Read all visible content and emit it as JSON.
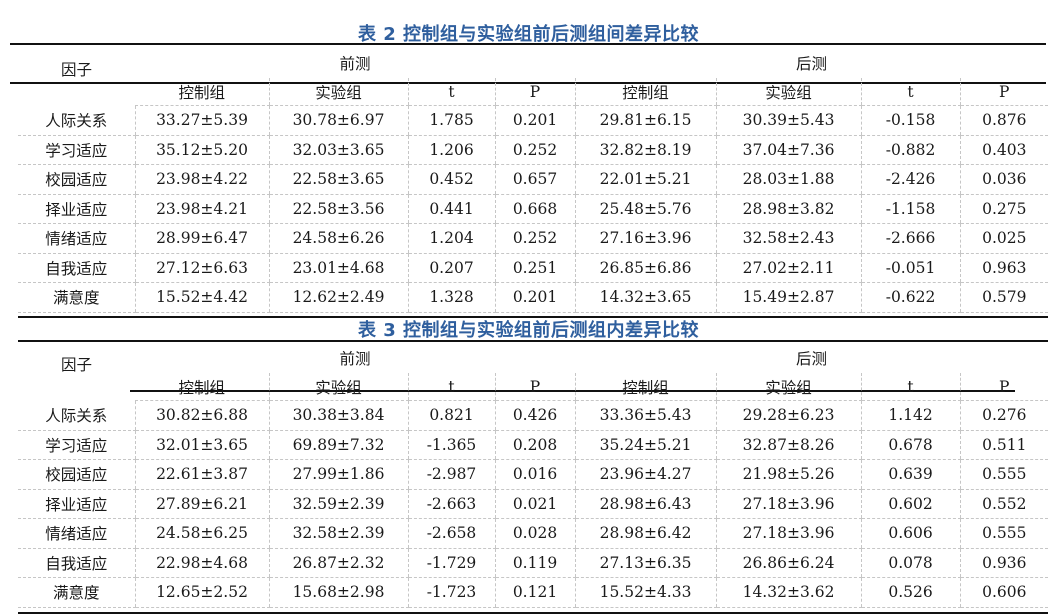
{
  "table2": {
    "title": "表 2   控制组与实验组前后测组间差异比较",
    "factor_header": "因子",
    "group_pre": "前测",
    "group_post": "后测",
    "columns": [
      "控制组",
      "实验组",
      "t",
      "P",
      "控制组",
      "实验组",
      "t",
      "P"
    ],
    "rows": [
      [
        "人际关系",
        "33.27±5.39",
        "30.78±6.97",
        "1.785",
        "0.201",
        "29.81±6.15",
        "30.39±5.43",
        "-0.158",
        "0.876"
      ],
      [
        "学习适应",
        "35.12±5.20",
        "32.03±3.65",
        "1.206",
        "0.252",
        "32.82±8.19",
        "37.04±7.36",
        "-0.882",
        "0.403"
      ],
      [
        "校园适应",
        "23.98±4.22",
        "22.58±3.65",
        "0.452",
        "0.657",
        "22.01±5.21",
        "28.03±1.88",
        "-2.426",
        "0.036"
      ],
      [
        "择业适应",
        "23.98±4.21",
        "22.58±3.56",
        "0.441",
        "0.668",
        "25.48±5.76",
        "28.98±3.82",
        "-1.158",
        "0.275"
      ],
      [
        "情绪适应",
        "28.99±6.47",
        "24.58±6.26",
        "1.204",
        "0.252",
        "27.16±3.96",
        "32.58±2.43",
        "-2.666",
        "0.025"
      ],
      [
        "自我适应",
        "27.12±6.63",
        "23.01±4.68",
        "0.207",
        "0.251",
        "26.85±6.86",
        "27.02±2.11",
        "-0.051",
        "0.963"
      ],
      [
        "满意度",
        "15.52±4.42",
        "12.62±2.49",
        "1.328",
        "0.201",
        "14.32±3.65",
        "15.49±2.87",
        "-0.622",
        "0.579"
      ]
    ]
  },
  "table3": {
    "title": "表 3  控制组与实验组前后测组内差异比较",
    "factor_header": "因子",
    "group_pre": "前测",
    "group_post": "后测",
    "columns": [
      "控制组",
      "实验组",
      "t",
      "P",
      "控制组",
      "实验组",
      "t",
      "P"
    ],
    "rows": [
      [
        "人际关系",
        "30.82±6.88",
        "30.38±3.84",
        "0.821",
        "0.426",
        "33.36±5.43",
        "29.28±6.23",
        "1.142",
        "0.276"
      ],
      [
        "学习适应",
        "32.01±3.65",
        "69.89±7.32",
        "-1.365",
        "0.208",
        "35.24±5.21",
        "32.87±8.26",
        "0.678",
        "0.511"
      ],
      [
        "校园适应",
        "22.61±3.87",
        "27.99±1.86",
        "-2.987",
        "0.016",
        "23.96±4.27",
        "21.98±5.26",
        "0.639",
        "0.555"
      ],
      [
        "择业适应",
        "27.89±6.21",
        "32.59±2.39",
        "-2.663",
        "0.021",
        "28.98±6.43",
        "27.18±3.96",
        "0.602",
        "0.552"
      ],
      [
        "情绪适应",
        "24.58±6.25",
        "32.58±2.39",
        "-2.658",
        "0.028",
        "28.98±6.42",
        "27.18±3.96",
        "0.606",
        "0.555"
      ],
      [
        "自我适应",
        "22.98±4.68",
        "26.87±2.32",
        "-1.729",
        "0.119",
        "27.13±6.35",
        "26.86±6.24",
        "0.078",
        "0.936"
      ],
      [
        "满意度",
        "12.65±2.52",
        "15.68±2.98",
        "-1.723",
        "0.121",
        "15.52±4.33",
        "14.32±3.62",
        "0.526",
        "0.606"
      ]
    ]
  }
}
